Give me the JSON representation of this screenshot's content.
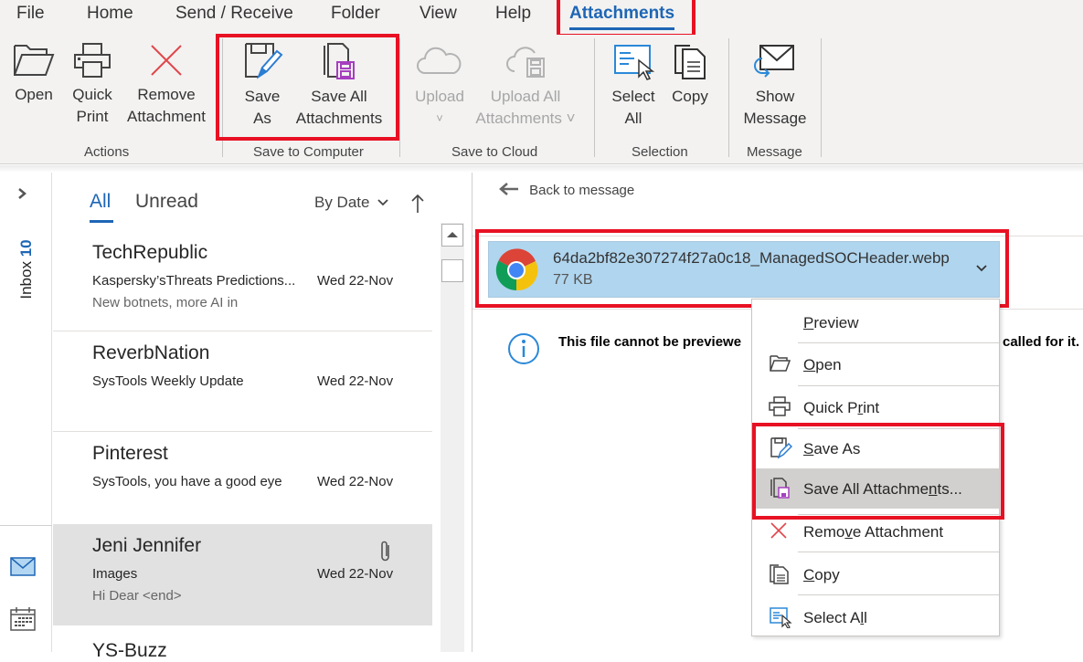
{
  "menu_tabs": [
    {
      "label": "File",
      "active": false
    },
    {
      "label": "Home",
      "active": false
    },
    {
      "label": "Send / Receive",
      "active": false
    },
    {
      "label": "Folder",
      "active": false
    },
    {
      "label": "View",
      "active": false
    },
    {
      "label": "Help",
      "active": false
    },
    {
      "label": "Attachments",
      "active": true
    }
  ],
  "ribbon": {
    "groups": [
      {
        "label": "Actions",
        "buttons": [
          {
            "label1": "Open",
            "label2": "",
            "icon": "folder-open-icon"
          },
          {
            "label1": "Quick",
            "label2": "Print",
            "icon": "printer-icon"
          },
          {
            "label1": "Remove",
            "label2": "Attachment",
            "icon": "remove-x-icon"
          }
        ]
      },
      {
        "label": "Save to Computer",
        "buttons": [
          {
            "label1": "Save",
            "label2": "As",
            "icon": "save-as-icon"
          },
          {
            "label1": "Save All",
            "label2": "Attachments",
            "icon": "save-all-icon"
          }
        ]
      },
      {
        "label": "Save to Cloud",
        "buttons": [
          {
            "label1": "Upload",
            "label2": "˅",
            "icon": "cloud-upload-icon",
            "disabled": true
          },
          {
            "label1": "Upload All",
            "label2": "Attachments ˅",
            "icon": "cloud-save-all-icon",
            "disabled": true
          }
        ]
      },
      {
        "label": "Selection",
        "buttons": [
          {
            "label1": "Select",
            "label2": "All",
            "icon": "select-all-icon"
          },
          {
            "label1": "Copy",
            "label2": "",
            "icon": "copy-icon"
          }
        ]
      },
      {
        "label": "Message",
        "buttons": [
          {
            "label1": "Show",
            "label2": "Message",
            "icon": "show-message-icon"
          }
        ]
      }
    ]
  },
  "left_nav": {
    "expand_icon": "chevron-right-icon",
    "folder_label": "Inbox",
    "unread_count": "10",
    "mail_icon": "mail-icon",
    "calendar_icon": "calendar-icon"
  },
  "message_list": {
    "filters": [
      {
        "label": "All",
        "active": true
      },
      {
        "label": "Unread",
        "active": false
      }
    ],
    "sort_label": "By Date",
    "sort_direction_icon": "arrow-up-icon",
    "items": [
      {
        "sender": "TechRepublic",
        "subject": "Kaspersky’sThreats Predictions...",
        "preview": "New botnets, more AI in",
        "date": "Wed 22-Nov",
        "attachment": false,
        "selected": false
      },
      {
        "sender": "ReverbNation",
        "subject": "SysTools Weekly Update",
        "preview": "",
        "date": "Wed 22-Nov",
        "attachment": false,
        "selected": false
      },
      {
        "sender": "Pinterest",
        "subject": "SysTools, you have a good eye",
        "preview": "",
        "date": "Wed 22-Nov",
        "attachment": false,
        "selected": false
      },
      {
        "sender": "Jeni Jennifer",
        "subject": "Images",
        "preview": "Hi Dear <end>",
        "date": "Wed 22-Nov",
        "attachment": true,
        "selected": true
      },
      {
        "sender": "YS-Buzz",
        "subject": "",
        "preview": "",
        "date": "",
        "attachment": false,
        "selected": false
      }
    ]
  },
  "reading_pane": {
    "back_label": "Back to message",
    "attachment": {
      "filename": "64da2bf82e307274f27a0c18_ManagedSOCHeader.webp",
      "size": "77 KB",
      "icon": "chrome-icon"
    },
    "info_text_left": "This file cannot be previewe",
    "info_text_right": "called for it."
  },
  "context_menu": {
    "items": [
      {
        "label": "Preview",
        "underline_index": 0,
        "icon": ""
      },
      {
        "label": "Open",
        "underline_index": 0,
        "icon": "folder-open-icon"
      },
      {
        "label": "Quick Print",
        "underline_index": 7,
        "icon": "printer-icon"
      },
      {
        "label": "Save As",
        "underline_index": 0,
        "icon": "save-as-icon"
      },
      {
        "label": "Save All Attachments...",
        "underline_index": 17,
        "icon": "save-all-icon",
        "highlighted": true
      },
      {
        "label": "Remove Attachment",
        "underline_index": 4,
        "icon": "remove-x-icon"
      },
      {
        "label": "Copy",
        "underline_index": 0,
        "icon": "copy-icon"
      },
      {
        "label": "Select All",
        "underline_index": 8,
        "icon": "select-all-icon"
      }
    ]
  },
  "colors": {
    "accent": "#1e66b5",
    "highlight_box": "#e81123",
    "attachment_bg": "#b0d5ee",
    "selected_row": "#e1e1e1"
  }
}
